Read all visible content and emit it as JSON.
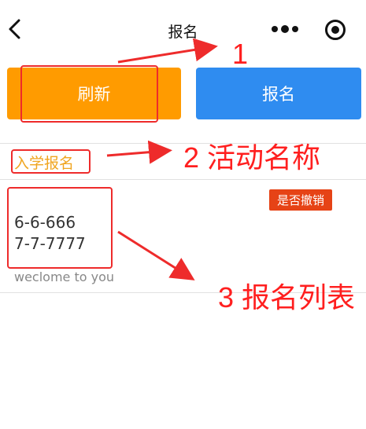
{
  "nav": {
    "title": "报名",
    "back_icon": "chevron-left-icon",
    "more_icon": "more-dots-icon",
    "target_icon": "record-target-icon"
  },
  "actions": {
    "refresh_label": "刷新",
    "signup_label": "报名"
  },
  "activity": {
    "name": "入学报名"
  },
  "entries": [
    {
      "lines": [
        "6-6-666",
        "7-7-7777"
      ],
      "subtitle": "weclome to you",
      "cancel_label": "是否撤销"
    }
  ],
  "annotations": {
    "label_1": "1",
    "label_2": "2 活动名称",
    "label_3": "3 报名列表",
    "color": "#ee2b2b"
  },
  "colors": {
    "refresh_button": "#ff9b00",
    "signup_button": "#2f8cf0",
    "activity_text": "#f0a520",
    "cancel_badge": "#e64316"
  }
}
